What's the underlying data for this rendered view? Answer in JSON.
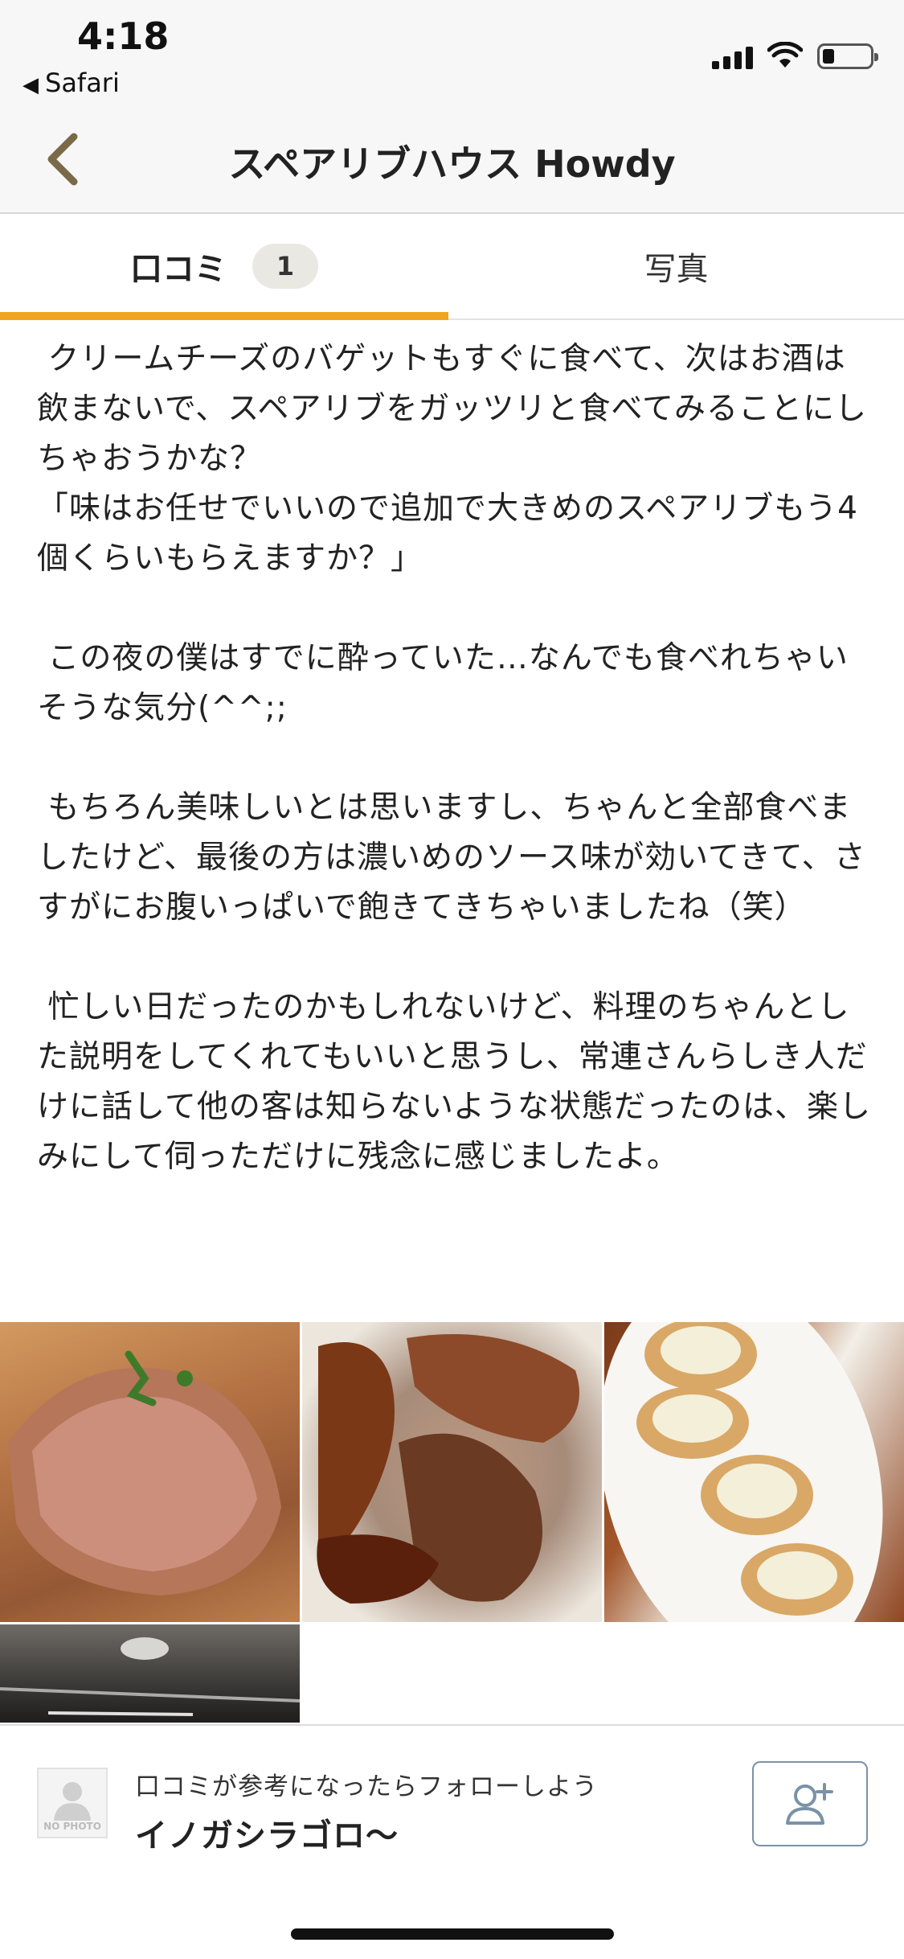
{
  "status_bar": {
    "time": "4:18",
    "back_app": "Safari",
    "back_icon": "back-triangle-icon"
  },
  "nav": {
    "title": "スペアリブハウス Howdy",
    "back_icon": "chevron-left-icon"
  },
  "tabs": [
    {
      "label": "口コミ",
      "count": "1",
      "active": true
    },
    {
      "label": "写真",
      "active": false
    }
  ],
  "colors": {
    "accent": "#f1a41d",
    "follow_border": "#7a92a7"
  },
  "review": {
    "text": " クリームチーズのバゲットもすぐに食べて、次はお酒は飲まないで、スペアリブをガッツリと食べてみることにしちゃおうかな？\n「味はお任せでいいので追加で大きめのスペアリブもう4個くらいもらえますか？」\n\n この夜の僕はすでに酔っていた…なんでも食べれちゃいそうな気分(^^;;\n\n もちろん美味しいとは思いますし、ちゃんと全部食べましたけど、最後の方は濃いめのソース味が効いてきて、さすがにお腹いっぱいで飽きてきちゃいましたね（笑）\n\n 忙しい日だったのかもしれないけど、料理のちゃんとした説明をしてくれてもいいと思うし、常連さんらしき人だけに話して他の客は知らないような状態だったのは、楽しみにして伺っただけに残念に感じましたよ。"
  },
  "photos": [
    {
      "name": "photo-grilled-sparerib"
    },
    {
      "name": "photo-glazed-spareribs"
    },
    {
      "name": "photo-cream-cheese-baguette"
    },
    {
      "name": "photo-restaurant-interior"
    }
  ],
  "footer": {
    "avatar_label": "NO PHOTO",
    "prompt": "口コミが参考になったらフォローしよう",
    "user_name": "イノガシラゴロ〜",
    "follow_icon": "add-user-icon"
  }
}
